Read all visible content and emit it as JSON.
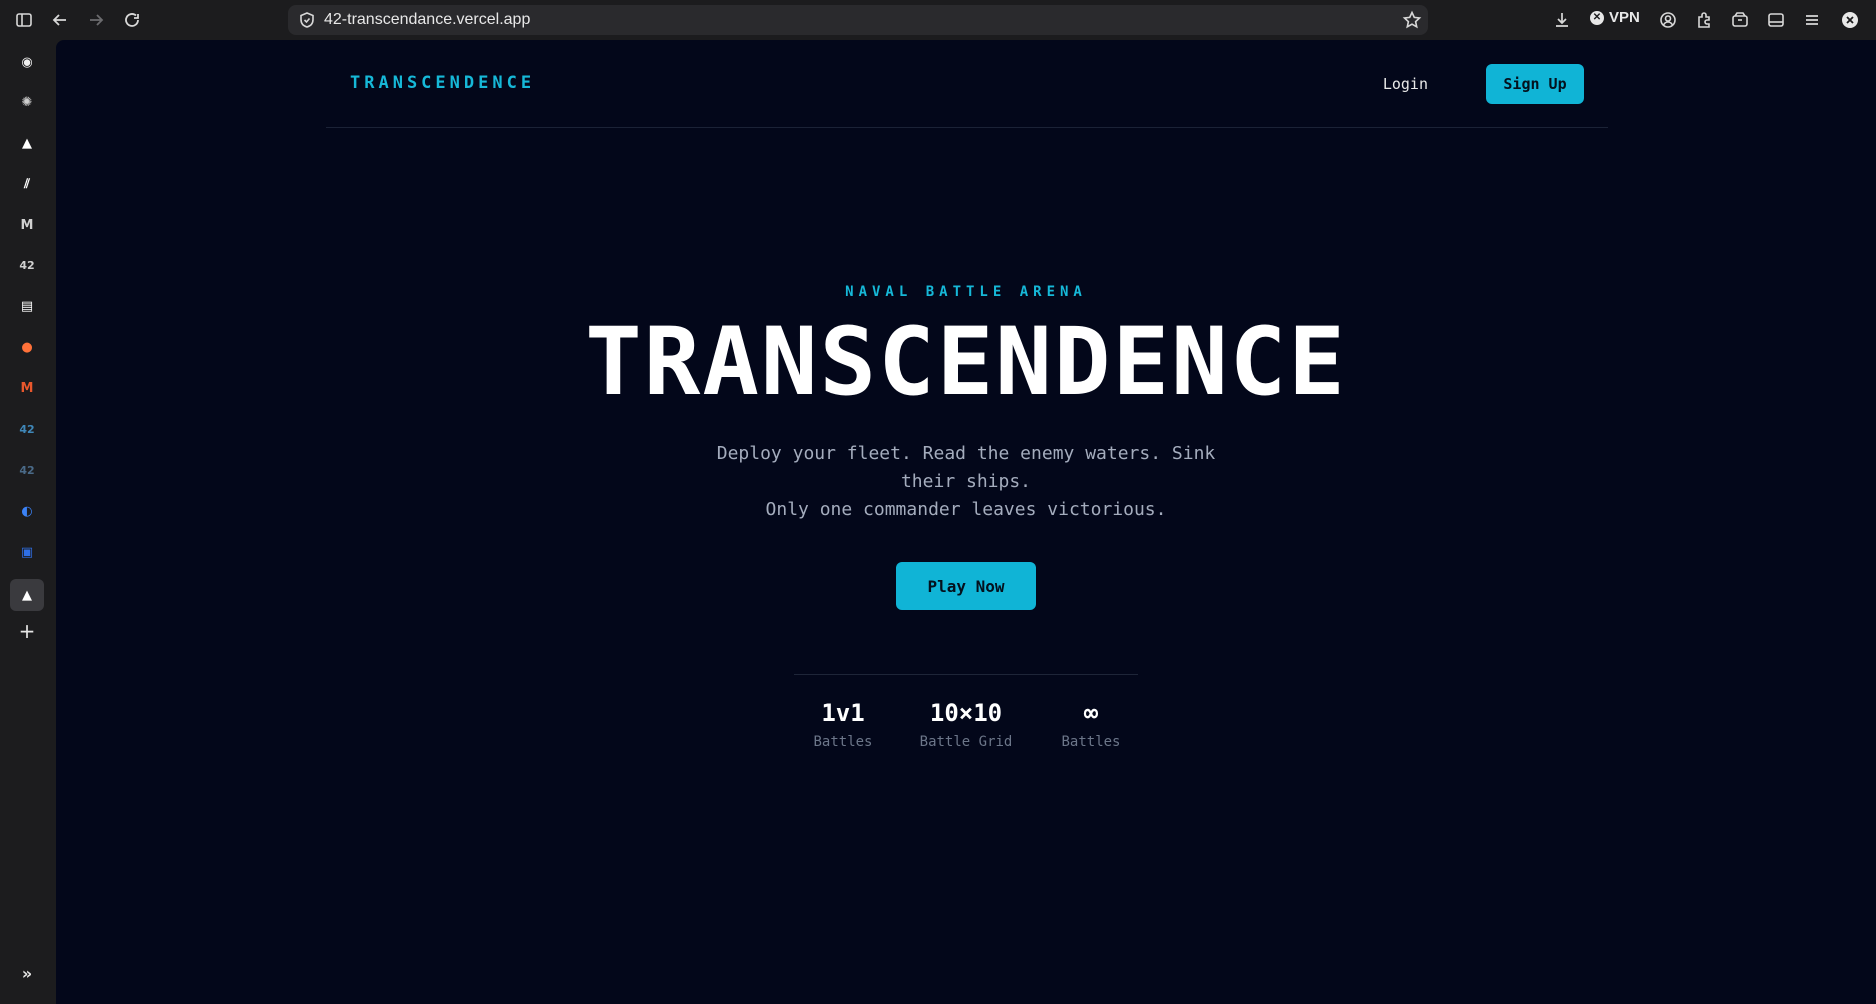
{
  "browser": {
    "url": "42-transcendance.vercel.app",
    "vpn_label": "VPN"
  },
  "sidebar": {
    "items": [
      {
        "name": "github-icon",
        "glyph": "◉"
      },
      {
        "name": "chatgpt-icon",
        "glyph": "✺"
      },
      {
        "name": "vercel-icon",
        "glyph": "▲"
      },
      {
        "name": "linear-icon",
        "glyph": "⫽"
      },
      {
        "name": "m-app-icon",
        "glyph": "M"
      },
      {
        "name": "42-icon",
        "glyph": "42"
      },
      {
        "name": "document-icon",
        "glyph": "▤"
      },
      {
        "name": "firefox-icon",
        "glyph": "●"
      },
      {
        "name": "gmail-icon",
        "glyph": "M"
      },
      {
        "name": "42-intra-icon",
        "glyph": "42"
      },
      {
        "name": "42-profile-icon",
        "glyph": "42"
      },
      {
        "name": "copilot-icon",
        "glyph": "◐"
      },
      {
        "name": "app-icon",
        "glyph": "▣"
      },
      {
        "name": "vercel-active-icon",
        "glyph": "▲"
      }
    ]
  },
  "nav": {
    "brand": "TRANSCENDENCE",
    "login": "Login",
    "signup": "Sign Up"
  },
  "hero": {
    "eyebrow": "NAVAL BATTLE ARENA",
    "title": "TRANSCENDENCE",
    "tagline_line1": "Deploy your fleet. Read the enemy waters. Sink their ships.",
    "tagline_line2": "Only one commander leaves victorious.",
    "play": "Play Now"
  },
  "stats": [
    {
      "value": "1v1",
      "label": "Battles"
    },
    {
      "value": "10×10",
      "label": "Battle Grid"
    },
    {
      "value": "∞",
      "label": "Battles"
    }
  ],
  "colors": {
    "accent": "#10b4d6",
    "background": "#03071a"
  }
}
